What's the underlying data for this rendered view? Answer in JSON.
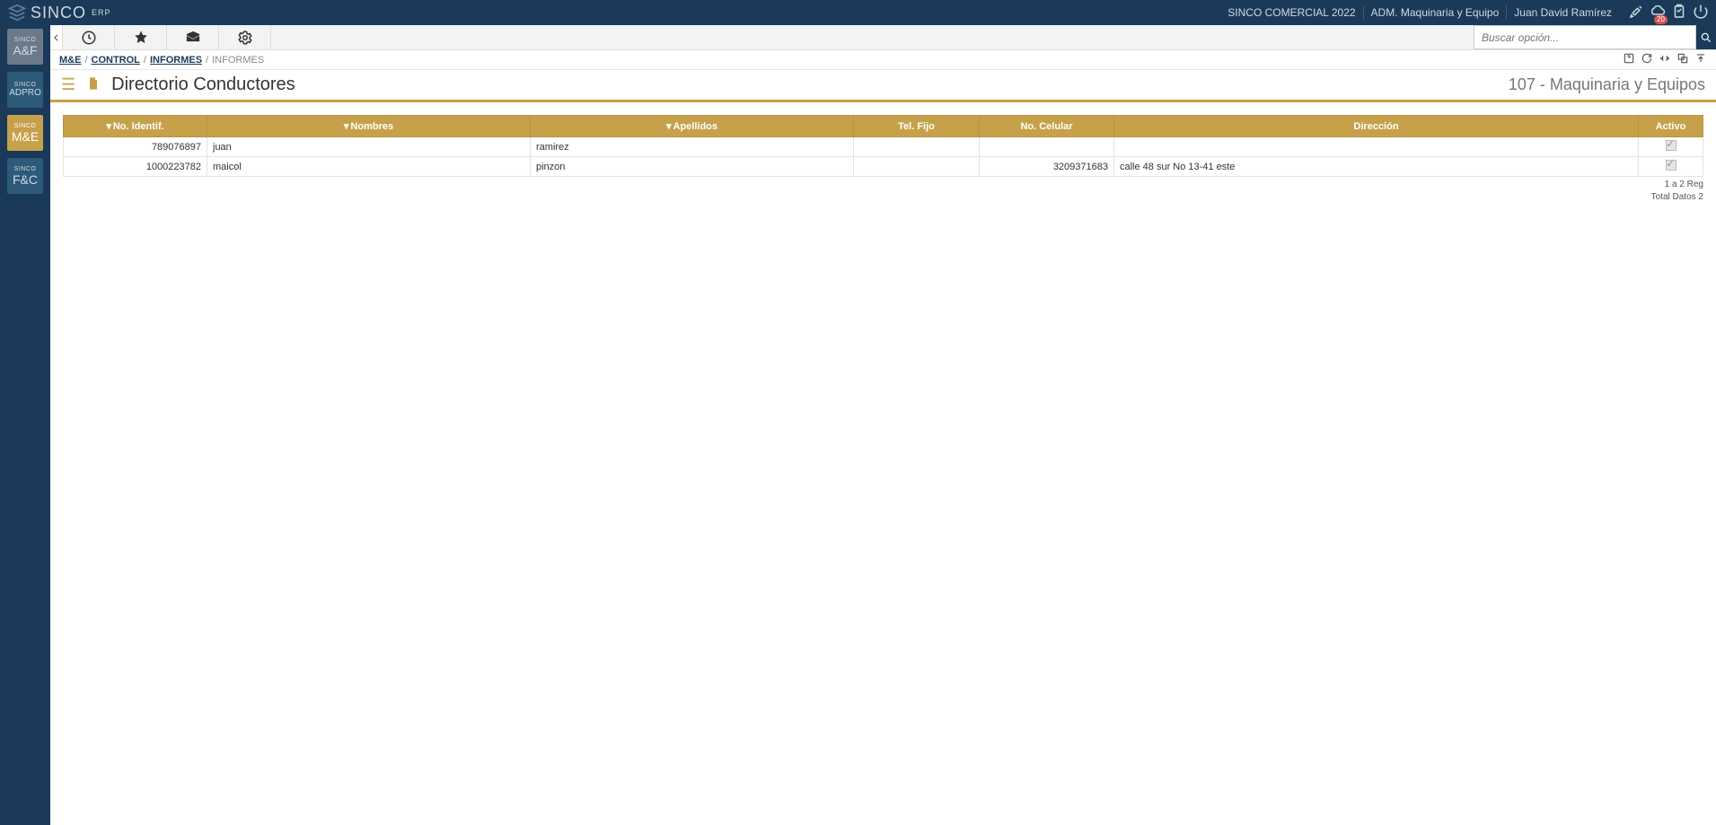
{
  "header": {
    "brand_main": "SINCO",
    "brand_sub": "ERP",
    "company": "SINCO COMERCIAL 2022",
    "module": "ADM. Maquinaria y Equipo",
    "user": "Juan David Ramírez",
    "cloud_badge": "20"
  },
  "search": {
    "placeholder": "Buscar opción..."
  },
  "sidebar": {
    "items": [
      {
        "sinco": "SINCO",
        "code": "A&F"
      },
      {
        "sinco": "SINCO",
        "code": "ADPRO"
      },
      {
        "sinco": "SINCO",
        "code": "M&E"
      },
      {
        "sinco": "SINCO",
        "code": "F&C"
      }
    ]
  },
  "breadcrumb": {
    "parts": [
      "M&E",
      "CONTROL",
      "INFORMES",
      "INFORMES"
    ]
  },
  "page": {
    "title": "Directorio Conductores",
    "context": "107 - Maquinaria y Equipos"
  },
  "table": {
    "columns": [
      "No. Identif.",
      "Nombres",
      "Apellidos",
      "Tel. Fijo",
      "No. Celular",
      "Dirección",
      "Activo"
    ],
    "rows": [
      {
        "id": "789076897",
        "nombres": "juan",
        "apellidos": "ramirez",
        "tel": "",
        "cel": "",
        "dir": "",
        "activo": true
      },
      {
        "id": "1000223782",
        "nombres": "maicol",
        "apellidos": "pinzon",
        "tel": "",
        "cel": "3209371683",
        "dir": "calle 48 sur No 13-41 este",
        "activo": true
      }
    ],
    "footer_range": "1 a 2 Reg",
    "footer_total": "Total Datos 2"
  }
}
